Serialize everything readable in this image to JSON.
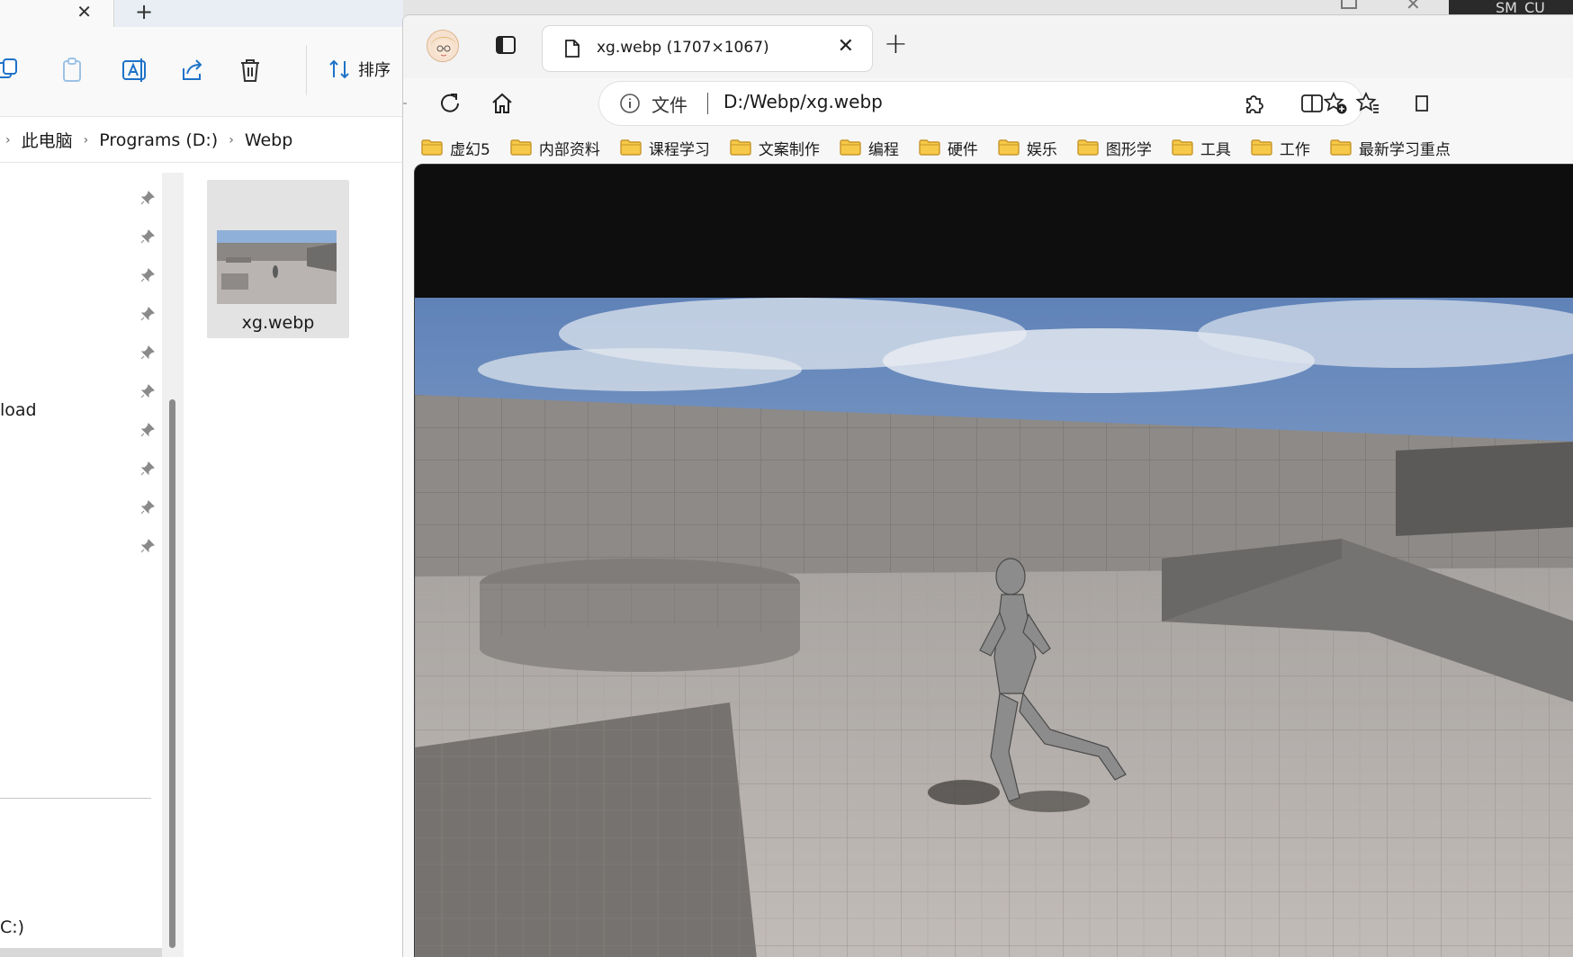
{
  "explorer": {
    "tab_close_glyph": "✕",
    "new_tab_glyph": "+",
    "toolbar": {
      "sort_label": "排序"
    },
    "breadcrumb": {
      "items": [
        "此电脑",
        "Programs (D:)",
        "Webp"
      ],
      "separator": "›"
    },
    "nav": {
      "partial_item_download": "load",
      "partial_item_drive": "C:)"
    },
    "file": {
      "name": "xg.webp"
    }
  },
  "background_window": {
    "label": "SM_CU"
  },
  "browser": {
    "tab": {
      "title": "xg.webp (1707×1067)",
      "close_glyph": "✕"
    },
    "new_tab_glyph": "+",
    "address": {
      "scheme_label": "文件",
      "url": "D:/Webp/xg.webp"
    },
    "bookmarks": [
      "虚幻5",
      "内部资料",
      "课程学习",
      "文案制作",
      "编程",
      "硬件",
      "娱乐",
      "图形学",
      "工具",
      "工作",
      "最新学习重点"
    ],
    "colors": {
      "folder_fill": "#f7c948",
      "folder_stroke": "#c7962a",
      "viewport_background": "#0e0e0e",
      "sky": "#7f9fcc",
      "floor": "#b9b4b1",
      "wall": "#8d8a87"
    }
  }
}
